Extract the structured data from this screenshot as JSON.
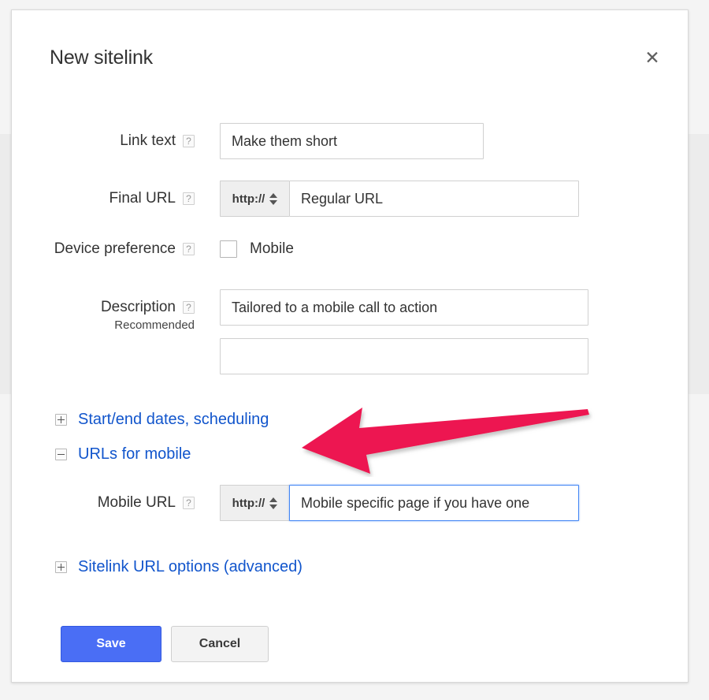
{
  "dialog": {
    "title": "New sitelink",
    "close_label": "✕"
  },
  "fields": {
    "link_text": {
      "label": "Link text",
      "help": "?",
      "value": "Make them short"
    },
    "final_url": {
      "label": "Final URL",
      "help": "?",
      "protocol": "http://",
      "value": "Regular URL"
    },
    "device_preference": {
      "label": "Device preference",
      "help": "?",
      "checkbox_label": "Mobile",
      "checked": false
    },
    "description": {
      "label": "Description",
      "sub_label": "Recommended",
      "help": "?",
      "line1": "Tailored to a mobile call to action",
      "line2": ""
    },
    "mobile_url": {
      "label": "Mobile URL",
      "help": "?",
      "protocol": "http://",
      "value": "Mobile specific page if you have one",
      "focused": true
    }
  },
  "expanders": [
    {
      "label": "Start/end dates, scheduling",
      "state": "collapsed",
      "glyph": "+"
    },
    {
      "label": "URLs for mobile",
      "state": "expanded",
      "glyph": "−"
    },
    {
      "label": "Sitelink URL options (advanced)",
      "state": "collapsed",
      "glyph": "+"
    }
  ],
  "buttons": {
    "save": "Save",
    "cancel": "Cancel"
  },
  "annotation": {
    "type": "arrow",
    "direction": "left",
    "color": "#ed1651",
    "points_at": "URLs for mobile"
  },
  "colors": {
    "link": "#1155cc",
    "primary_button": "#4a6ef5",
    "focus_border": "#4285f4",
    "arrow": "#ed1651"
  }
}
